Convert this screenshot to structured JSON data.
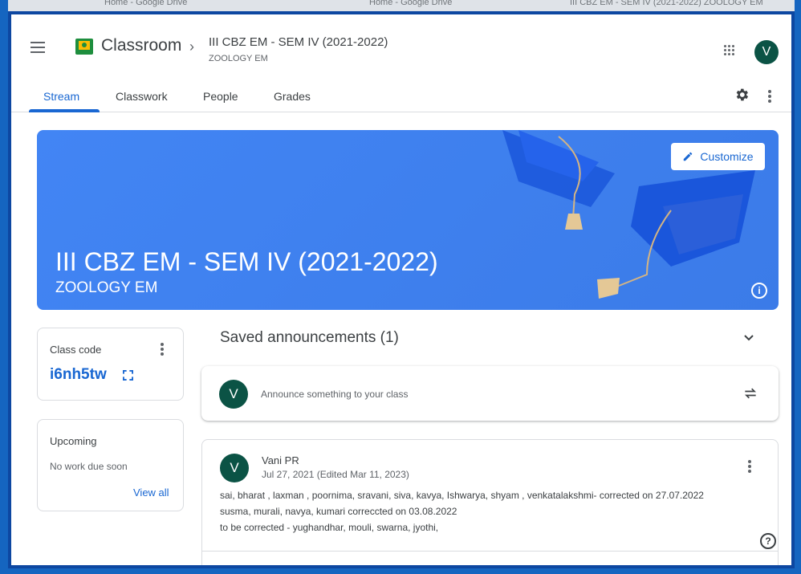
{
  "browser_tabs": [
    "Home - Google Drive",
    "Home - Google Drive",
    "III CBZ EM - SEM IV (2021-2022) ZOOLOGY EM"
  ],
  "header": {
    "app_title": "Classroom",
    "class_title": "III CBZ EM - SEM IV (2021-2022)",
    "class_sub": "ZOOLOGY EM",
    "avatar_letter": "V"
  },
  "tabs": [
    {
      "label": "Stream",
      "active": true
    },
    {
      "label": "Classwork",
      "active": false
    },
    {
      "label": "People",
      "active": false
    },
    {
      "label": "Grades",
      "active": false
    }
  ],
  "banner": {
    "title": "III CBZ EM - SEM IV (2021-2022)",
    "subtitle": "ZOOLOGY EM",
    "customize_label": "Customize"
  },
  "class_code": {
    "label": "Class code",
    "value": "i6nh5tw"
  },
  "upcoming": {
    "title": "Upcoming",
    "empty_text": "No work due soon",
    "view_all": "View all"
  },
  "stream": {
    "saved_title": "Saved announcements (1)",
    "announce_placeholder": "Announce something to your class",
    "avatar_letter": "V"
  },
  "post": {
    "author": "Vani PR",
    "date": "Jul 27, 2021 (Edited Mar 11, 2023)",
    "avatar_letter": "V",
    "lines": [
      "sai, bharat , laxman , poornima, sravani, siva, kavya, Ishwarya, shyam , venkatalakshmi-  corrected on 27.07.2022",
      "susma, murali, navya, kumari correccted on 03.08.2022",
      "to be corrected - yughandhar, mouli, swarna, jyothi,"
    ]
  },
  "colors": {
    "accent": "#1967d2",
    "banner": "#4285f4",
    "avatar": "#0b5345"
  }
}
